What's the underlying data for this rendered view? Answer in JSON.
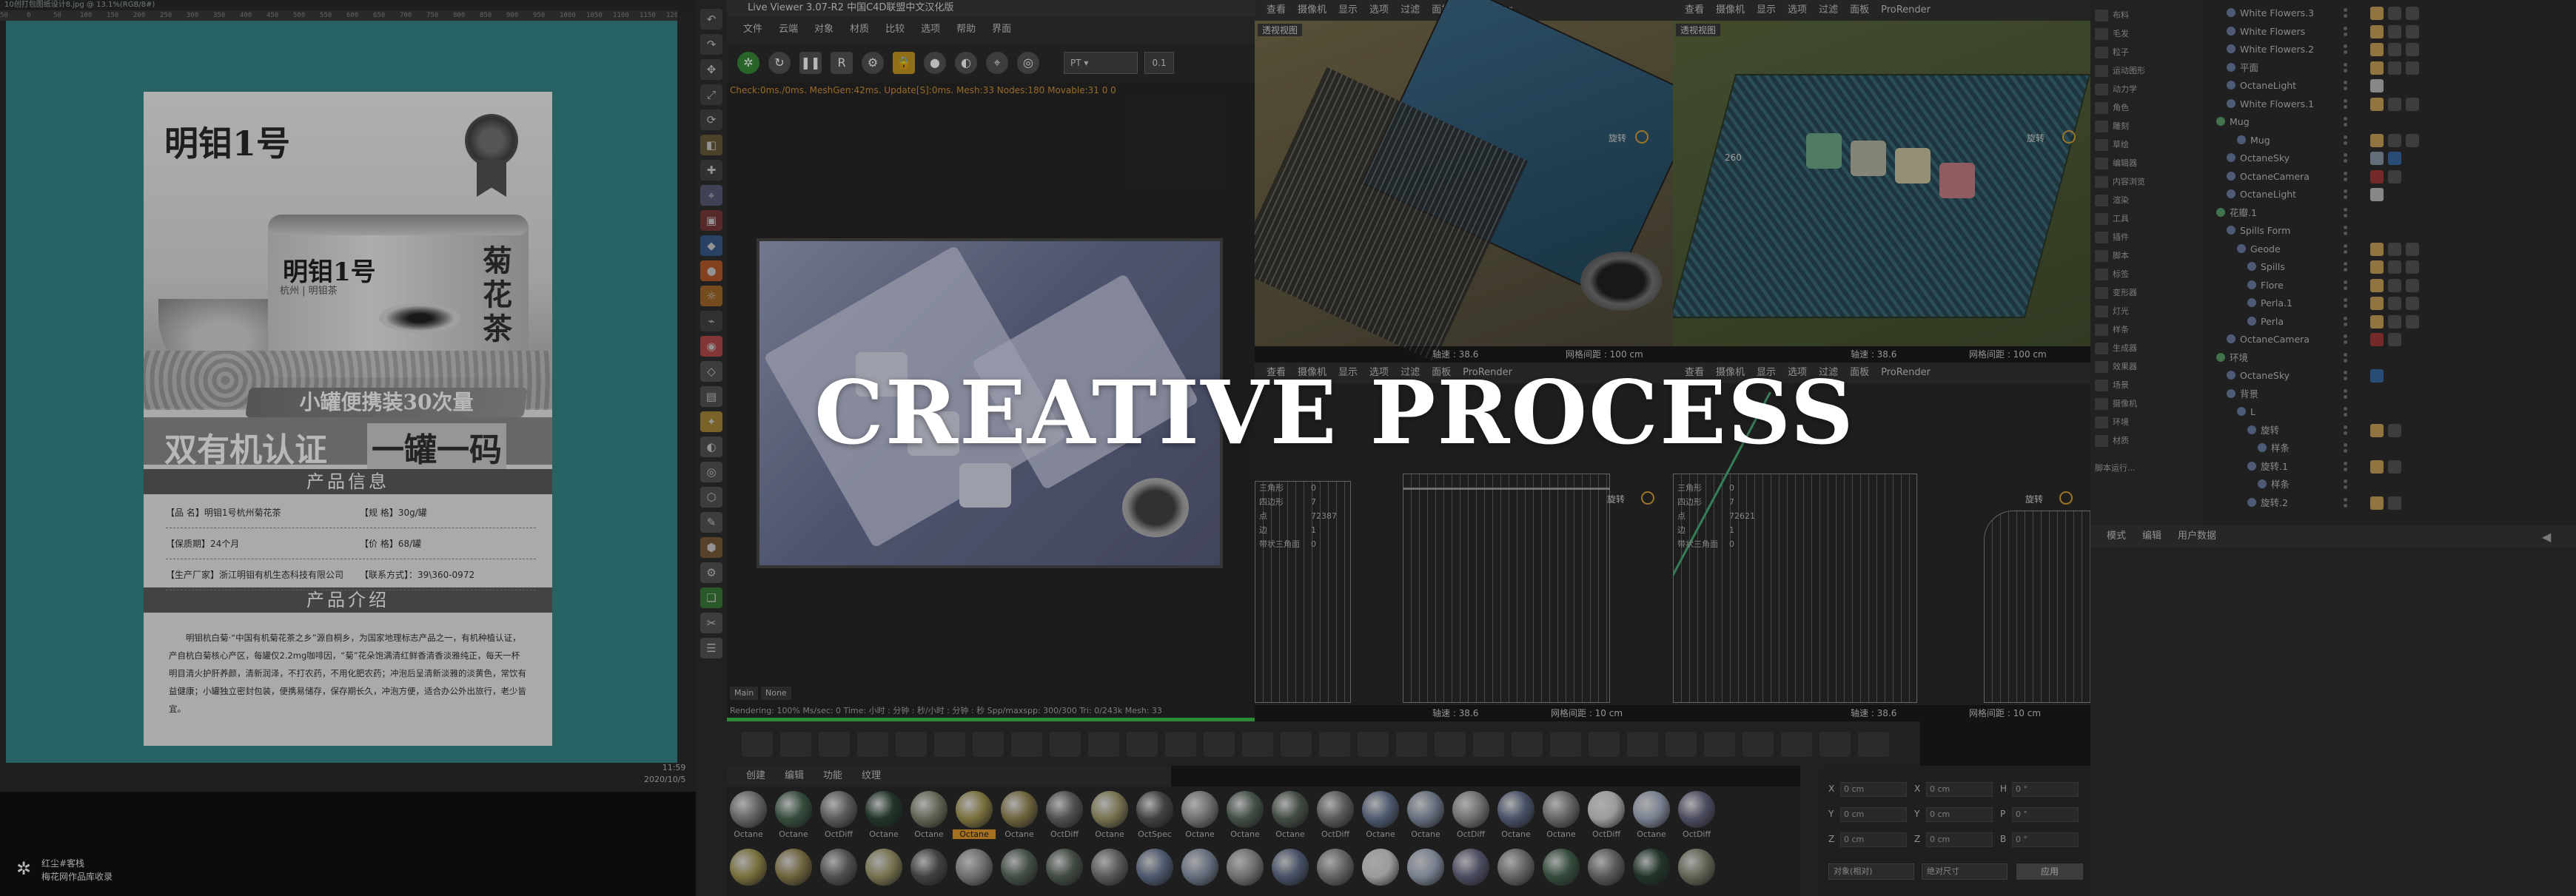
{
  "headline": "CREATIVE PROCESS",
  "photoshop": {
    "doc_title": "10创打包图纸设计8.jpg @ 13.1%(RGB/8#)",
    "ruler_ticks": [
      "50",
      "0",
      "50",
      "100",
      "150",
      "200",
      "250",
      "300",
      "350",
      "400",
      "450",
      "500",
      "550",
      "600",
      "650",
      "700",
      "750",
      "800",
      "850",
      "900",
      "950",
      "1000",
      "1050",
      "1100",
      "1150",
      "1200",
      "1250",
      "1300"
    ],
    "clock_time": "11:59",
    "clock_date": "2020/10/5"
  },
  "poster": {
    "brand": "明钼1号",
    "tin_brand": "明钼1号",
    "tin_sub": "杭州 | 明钼茶",
    "variety": "菊花茶",
    "pack_slogan": "小罐便携装30次量",
    "cert_left": "双有机认证",
    "cert_right": "一罐一码",
    "info_title": "产品信息",
    "info_rows": [
      {
        "left": "【品 名】明钼1号杭州菊花茶",
        "right": "【规 格】30g/罐"
      },
      {
        "left": "【保质期】24个月",
        "right": "【价 格】68/罐"
      },
      {
        "left": "【生产厂家】浙江明钼有机生态科技有限公司",
        "right": "【联系方式】：39\\360-0972"
      }
    ],
    "intro_title": "产品介绍",
    "intro_text": "明钼杭白菊·“中国有机菊花茶之乡”源自桐乡，为国家地理标志产品之一，有机种植认证，产自杭白菊核心产区，每罐仅2.2mg咖啡因，“菊”花朵饱满清红鲜香清香淡雅纯正，每天一杯明目清火护肝养颜，清新润泽，不打农药，不用化肥农药；冲泡后呈清新淡雅的淡黄色，常饮有益健康；小罐独立密封包装，便携易储存，保存期长久，冲泡方便，适合办公外出旅行，老少皆宜。"
  },
  "watermark": {
    "line1": "红尘#客栈",
    "line2": "梅花网作品库收录"
  },
  "live_viewer": {
    "title": "Live Viewer 3.07-R2 中国C4D联盟中文汉化版",
    "menu": [
      "文件",
      "云端",
      "对象",
      "材质",
      "比较",
      "选项",
      "帮助",
      "界面"
    ],
    "select_value": "PT",
    "spinner_value": "0.1",
    "stats": "Check:0ms./0ms. MeshGen:42ms. Update[S]:0ms. Mesh:33 Nodes:180 Movable:31  0  0",
    "main_tag": "Main",
    "none_tag": "None",
    "status": "Rendering: 100%   Ms/sec: 0   Time: 小时 : 分钟 : 秒/小时 : 分钟 : 秒   Spp/maxspp: 300/300   Tri: 0/243k   Mesh: 33"
  },
  "viewports": {
    "menu": [
      "查看",
      "摄像机",
      "显示",
      "选项",
      "过滤",
      "面板",
      "ProRender"
    ],
    "tl": {
      "camera": "透视视图",
      "rotate": "旋转",
      "foot_left": "轴速 : 38.6",
      "foot_right": "网格间距 : 100 cm"
    },
    "tr": {
      "camera": "透视视图",
      "rotate": "旋转",
      "foot_left": "轴速 : 38.6",
      "foot_right": "网格间距 : 100 cm",
      "dim": "260"
    },
    "bl": {
      "rotate": "旋转",
      "foot_left": "轴速 : 38.6",
      "foot_right": "网格间距 : 10 cm",
      "stats": [
        [
          "三角形",
          "0"
        ],
        [
          "四边形",
          "7"
        ],
        [
          "点",
          "72387"
        ],
        [
          "边",
          "1"
        ],
        [
          "带状三角面",
          "0"
        ]
      ]
    },
    "br": {
      "rotate": "旋转",
      "foot_left": "轴速 : 38.6",
      "foot_right": "网格间距 : 10 cm",
      "stats": [
        [
          "三角形",
          "0"
        ],
        [
          "四边形",
          "7"
        ],
        [
          "点",
          "72621"
        ],
        [
          "边",
          "1"
        ],
        [
          "带状三角面",
          "0"
        ]
      ]
    }
  },
  "materials": {
    "menu": [
      "创建",
      "编辑",
      "功能",
      "纹理"
    ],
    "row1": [
      "Octane",
      "Octane",
      "OctDiff",
      "Octane",
      "Octane",
      "Octane",
      "Octane",
      "OctDiff",
      "Octane",
      "OctSpec",
      "Octane",
      "Octane",
      "Octane",
      "OctDiff",
      "Octane",
      "Octane",
      "OctDiff",
      "Octane",
      "Octane",
      "OctDiff",
      "Octane",
      "OctDiff"
    ],
    "selected_label": "OctDiff",
    "selected_index": 5,
    "row2_count": 22,
    "colors": [
      "#8a8a8a",
      "#4a6b55",
      "#7c7c7c",
      "#2f4a3a",
      "#8b8b76",
      "#a99b55",
      "#9a8a55",
      "#6f6f6f",
      "#a59e6f",
      "#5b5b5b",
      "#9a9a9a",
      "#5e6f62",
      "#5c6a5e",
      "#7c7c7c",
      "#6d7c9a",
      "#8d9ab0",
      "#9a9a9a",
      "#64718f",
      "#8a8a8a",
      "#d8d8d8",
      "#a8b3c9",
      "#6b6b88"
    ]
  },
  "coords": {
    "rows": [
      [
        "X",
        "0 cm",
        "X",
        "0 cm",
        "H",
        "0 °"
      ],
      [
        "Y",
        "0 cm",
        "Y",
        "0 cm",
        "P",
        "0 °"
      ],
      [
        "Z",
        "0 cm",
        "Z",
        "0 cm",
        "B",
        "0 °"
      ]
    ],
    "dd1": "对象(相对)",
    "dd2": "绝对尺寸",
    "apply": "应用"
  },
  "panel_narrow": {
    "items": [
      "布料",
      "毛发",
      "粒子",
      "运动图形",
      "动力学",
      "角色",
      "雕刻",
      "草绘",
      "编辑器",
      "内容浏览",
      "渲染",
      "工具",
      "插件",
      "脚本",
      "标签",
      "变形器",
      "灯光",
      "样条",
      "生成器",
      "效果器",
      "场景",
      "摄像机",
      "环境",
      "材质"
    ],
    "footer": "脚本运行..."
  },
  "objects": [
    {
      "name": "White Flowers.3",
      "indent": 1,
      "tags": [
        "#c9a35a",
        "#555",
        "#555"
      ]
    },
    {
      "name": "White Flowers",
      "indent": 1,
      "tags": [
        "#c9a35a",
        "#555",
        "#555"
      ]
    },
    {
      "name": "White Flowers.2",
      "indent": 1,
      "tags": [
        "#c9a35a",
        "#555",
        "#555"
      ]
    },
    {
      "name": "平面",
      "indent": 1,
      "tags": [
        "#c9a35a",
        "#555",
        "#555"
      ]
    },
    {
      "name": "OctaneLight",
      "indent": 1,
      "tags": [
        "#bbbbbb"
      ]
    },
    {
      "name": "White Flowers.1",
      "indent": 1,
      "tags": [
        "#c9a35a",
        "#555",
        "#555"
      ]
    },
    {
      "name": "Mug",
      "indent": 0,
      "tags": []
    },
    {
      "name": "Mug",
      "indent": 2,
      "tags": [
        "#c9a35a",
        "#555",
        "#555"
      ]
    },
    {
      "name": "OctaneSky",
      "indent": 1,
      "tags": [
        "#8899aa",
        "#3a6aa5"
      ]
    },
    {
      "name": "OctaneCamera",
      "indent": 1,
      "tags": [
        "#a33a3a",
        "#555"
      ]
    },
    {
      "name": "OctaneLight",
      "indent": 1,
      "tags": [
        "#bbbbbb"
      ]
    },
    {
      "name": "花瓣.1",
      "indent": 0,
      "tags": []
    },
    {
      "name": "Spills Form",
      "indent": 1,
      "tags": []
    },
    {
      "name": "Geode",
      "indent": 2,
      "tags": [
        "#c9a35a",
        "#555",
        "#555"
      ]
    },
    {
      "name": "Spills",
      "indent": 3,
      "tags": [
        "#c9a35a",
        "#555",
        "#555"
      ]
    },
    {
      "name": "Flore",
      "indent": 3,
      "tags": [
        "#c9a35a",
        "#555",
        "#555"
      ]
    },
    {
      "name": "Perla.1",
      "indent": 3,
      "tags": [
        "#c9a35a",
        "#555",
        "#555"
      ]
    },
    {
      "name": "Perla",
      "indent": 3,
      "tags": [
        "#c9a35a",
        "#555",
        "#555"
      ]
    },
    {
      "name": "OctaneCamera",
      "indent": 1,
      "tags": [
        "#a33a3a",
        "#555"
      ]
    },
    {
      "name": "环境",
      "indent": 0,
      "tags": []
    },
    {
      "name": "OctaneSky",
      "indent": 1,
      "tags": [
        "#3a6aa5"
      ]
    },
    {
      "name": "背景",
      "indent": 1,
      "tags": []
    },
    {
      "name": "L",
      "indent": 2,
      "tags": []
    },
    {
      "name": "旋转",
      "indent": 3,
      "tags": [
        "#c9a35a",
        "#555"
      ]
    },
    {
      "name": "样条",
      "indent": 4,
      "tags": []
    },
    {
      "name": "旋转.1",
      "indent": 3,
      "tags": [
        "#c9a35a",
        "#555"
      ]
    },
    {
      "name": "样条",
      "indent": 4,
      "tags": []
    },
    {
      "name": "旋转.2",
      "indent": 3,
      "tags": [
        "#c9a35a",
        "#555"
      ]
    }
  ],
  "attr_menu": [
    "模式",
    "编辑",
    "用户数据"
  ]
}
